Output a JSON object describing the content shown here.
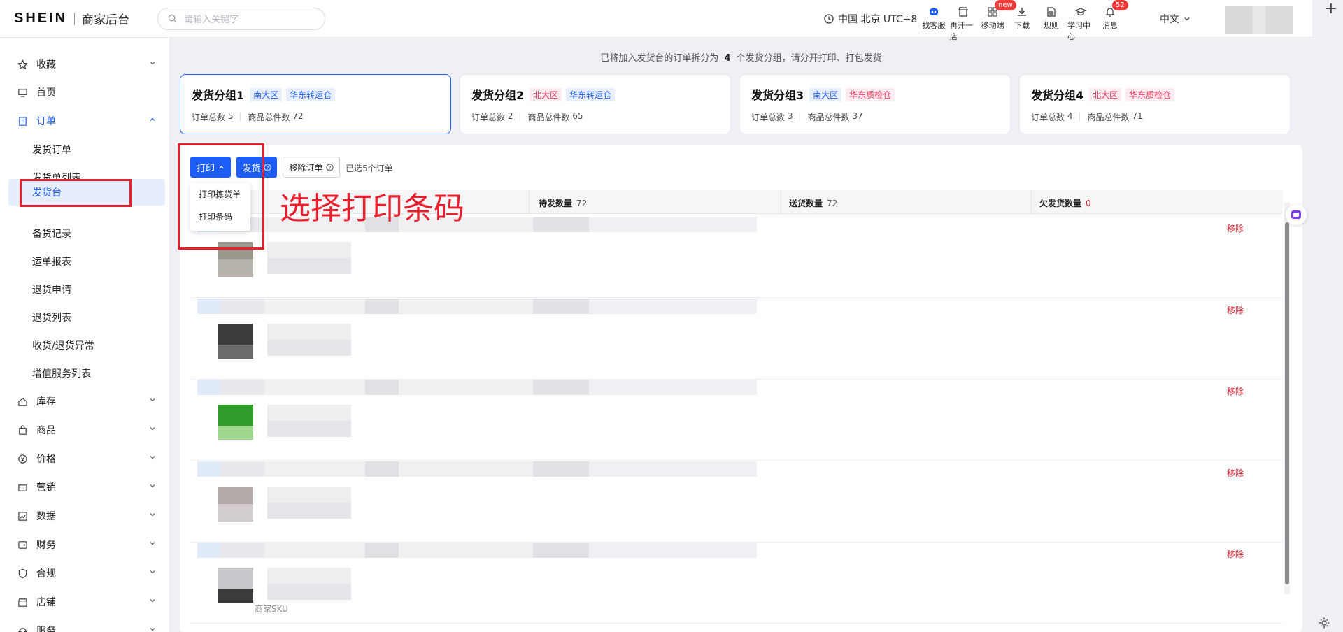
{
  "header": {
    "logo": "SHEIN",
    "subtitle": "商家后台",
    "search_placeholder": "请输入关键字",
    "timezone": "中国 北京 UTC+8",
    "tools": [
      {
        "label": "找客服",
        "icon": "robot-icon",
        "badge": ""
      },
      {
        "label": "再开一店",
        "icon": "store-icon",
        "badge": ""
      },
      {
        "label": "移动端",
        "icon": "apps-icon",
        "badge": "new"
      },
      {
        "label": "下载",
        "icon": "download-icon",
        "badge": ""
      },
      {
        "label": "规则",
        "icon": "document-icon",
        "badge": ""
      },
      {
        "label": "学习中心",
        "icon": "graduation-icon",
        "badge": ""
      },
      {
        "label": "消息",
        "icon": "bell-icon",
        "badge": "52"
      }
    ],
    "language": "中文",
    "plus": "+"
  },
  "sidebar": {
    "items": [
      {
        "label": "收藏",
        "icon": "star-icon"
      },
      {
        "label": "首页",
        "icon": "monitor-icon"
      },
      {
        "label": "订单",
        "icon": "order-icon"
      },
      {
        "label": "库存",
        "icon": "home-icon"
      },
      {
        "label": "商品",
        "icon": "bag-icon"
      },
      {
        "label": "价格",
        "icon": "price-icon"
      },
      {
        "label": "营销",
        "icon": "marketing-icon"
      },
      {
        "label": "数据",
        "icon": "chart-icon"
      },
      {
        "label": "财务",
        "icon": "wallet-icon"
      },
      {
        "label": "合规",
        "icon": "shield-icon"
      },
      {
        "label": "店铺",
        "icon": "shop-icon"
      },
      {
        "label": "服务",
        "icon": "service-icon"
      }
    ],
    "order_sub": [
      "发货订单",
      "发货单列表",
      "发货台",
      "备货记录",
      "运单报表",
      "退货申请",
      "退货列表",
      "收货/退货异常",
      "增值服务列表"
    ]
  },
  "main": {
    "notice_prefix": "已将加入发货台的订单拆分为",
    "notice_count": "4",
    "notice_suffix": "个发货分组，请分开打印、打包发货",
    "groups": [
      {
        "name": "发货分组1",
        "tags": [
          {
            "text": "南大区",
            "color": "blue"
          },
          {
            "text": "华东转运仓",
            "color": "blue"
          }
        ],
        "orders_label": "订单总数",
        "orders": "5",
        "items_label": "商品总件数",
        "items": "72"
      },
      {
        "name": "发货分组2",
        "tags": [
          {
            "text": "北大区",
            "color": "red"
          },
          {
            "text": "华东转运仓",
            "color": "blue"
          }
        ],
        "orders_label": "订单总数",
        "orders": "2",
        "items_label": "商品总件数",
        "items": "65"
      },
      {
        "name": "发货分组3",
        "tags": [
          {
            "text": "南大区",
            "color": "blue"
          },
          {
            "text": "华东质检仓",
            "color": "red"
          }
        ],
        "orders_label": "订单总数",
        "orders": "3",
        "items_label": "商品总件数",
        "items": "37"
      },
      {
        "name": "发货分组4",
        "tags": [
          {
            "text": "北大区",
            "color": "red"
          },
          {
            "text": "华东质检仓",
            "color": "red"
          }
        ],
        "orders_label": "订单总数",
        "orders": "4",
        "items_label": "商品总件数",
        "items": "71"
      }
    ],
    "buttons": {
      "print": "打印",
      "ship": "发货",
      "remove_order": "移除订单",
      "selected": "已选5个订单"
    },
    "dropdown": [
      "打印拣货单",
      "打印条码"
    ],
    "annotation": "选择打印条码",
    "table": {
      "headers": [
        {
          "label": "待发数量",
          "value": "72"
        },
        {
          "label": "送货数量",
          "value": "72"
        },
        {
          "label": "欠发货数量",
          "value": "0"
        }
      ],
      "row_action": "移除",
      "row_count": 5,
      "sku_label": "商家SKU"
    }
  },
  "colors": {
    "primary": "#1d5cf5",
    "danger": "#e8202e",
    "tag_red": "#e8365d"
  }
}
